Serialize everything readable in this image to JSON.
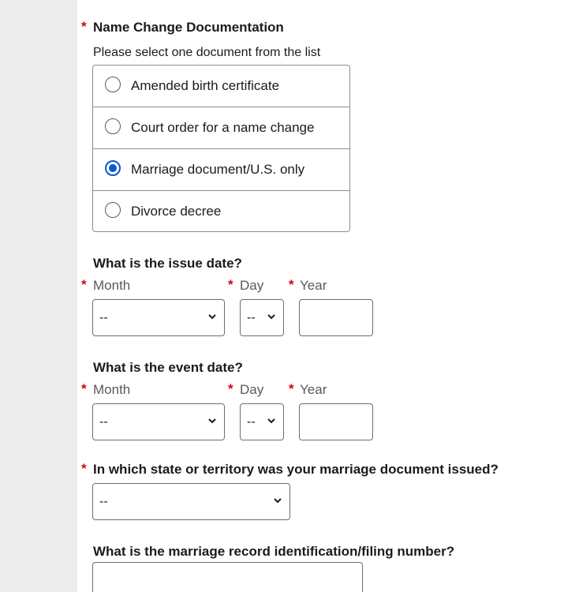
{
  "required_marker": "*",
  "doc_section": {
    "title": "Name Change Documentation",
    "hint": "Please select one document from the list",
    "options": [
      {
        "label": "Amended birth certificate",
        "selected": false
      },
      {
        "label": "Court order for a name change",
        "selected": false
      },
      {
        "label": "Marriage document/U.S. only",
        "selected": true
      },
      {
        "label": "Divorce decree",
        "selected": false
      }
    ]
  },
  "issue_date": {
    "title": "What is the issue date?",
    "month_label": "Month",
    "day_label": "Day",
    "year_label": "Year",
    "month_value": "--",
    "day_value": "--",
    "year_value": ""
  },
  "event_date": {
    "title": "What is the event date?",
    "month_label": "Month",
    "day_label": "Day",
    "year_label": "Year",
    "month_value": "--",
    "day_value": "--",
    "year_value": ""
  },
  "state_question": {
    "title": "In which state or territory was your marriage document issued?",
    "value": "--"
  },
  "record_number": {
    "title": "What is the marriage record identification/filing number?",
    "value": ""
  },
  "colors": {
    "required": "#d0021b",
    "radio_selected": "#0b57d0",
    "gutter": "#ececec"
  }
}
